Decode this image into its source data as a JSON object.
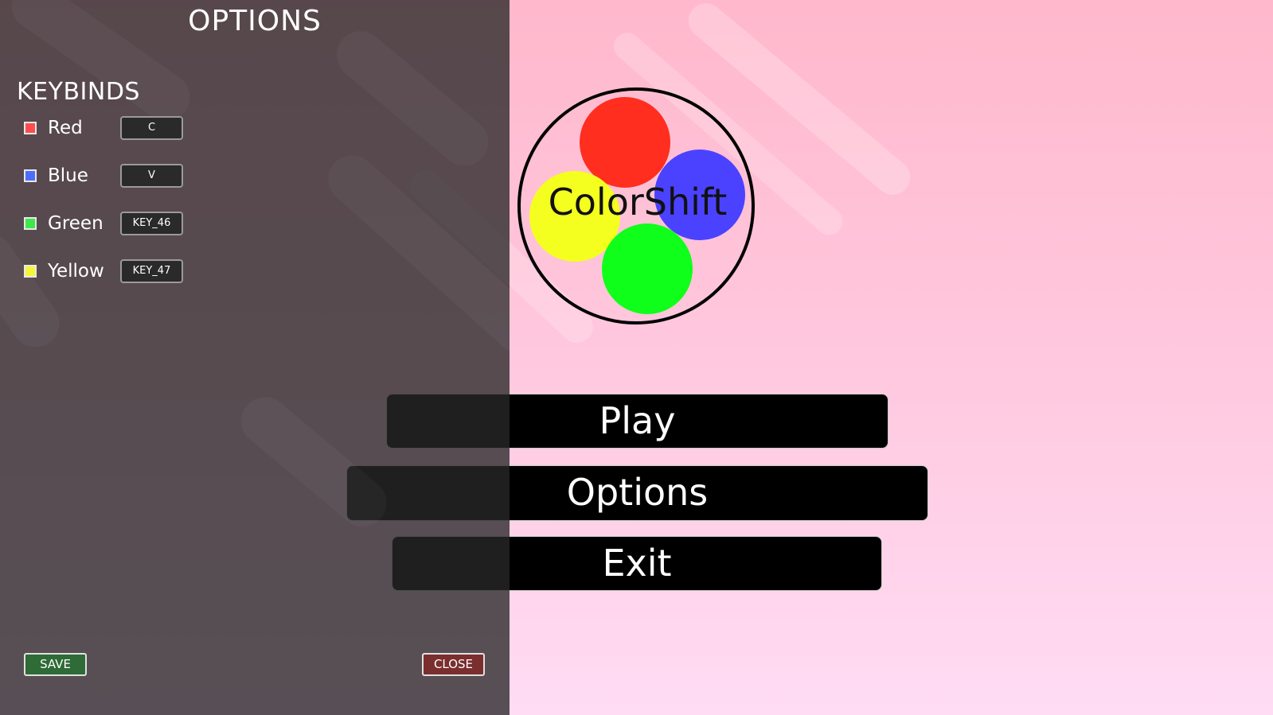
{
  "logo": {
    "title": "ColorShift",
    "circle_colors": {
      "red": "#ff2e1f",
      "blue": "#4b42ff",
      "yellow": "#f4ff1f",
      "green": "#0fff1a"
    }
  },
  "menu": {
    "play": "Play",
    "options": "Options",
    "exit": "Exit"
  },
  "options_panel": {
    "title": "OPTIONS",
    "section": "KEYBINDS",
    "keybinds": [
      {
        "label": "Red",
        "key": "C",
        "color": "#ff4d4d"
      },
      {
        "label": "Blue",
        "key": "V",
        "color": "#4d6dff"
      },
      {
        "label": "Green",
        "key": "KEY_46",
        "color": "#3ee84a"
      },
      {
        "label": "Yellow",
        "key": "KEY_47",
        "color": "#f5f53a"
      }
    ],
    "save_label": "SAVE",
    "close_label": "CLOSE"
  },
  "colors": {
    "background_top": "#ffb8cc",
    "background_bottom": "#ffdcf4",
    "panel_overlay": "#4a4446",
    "button_bg": "#000000",
    "save_bg": "#2e6b36",
    "close_bg": "#7a2e2e"
  }
}
